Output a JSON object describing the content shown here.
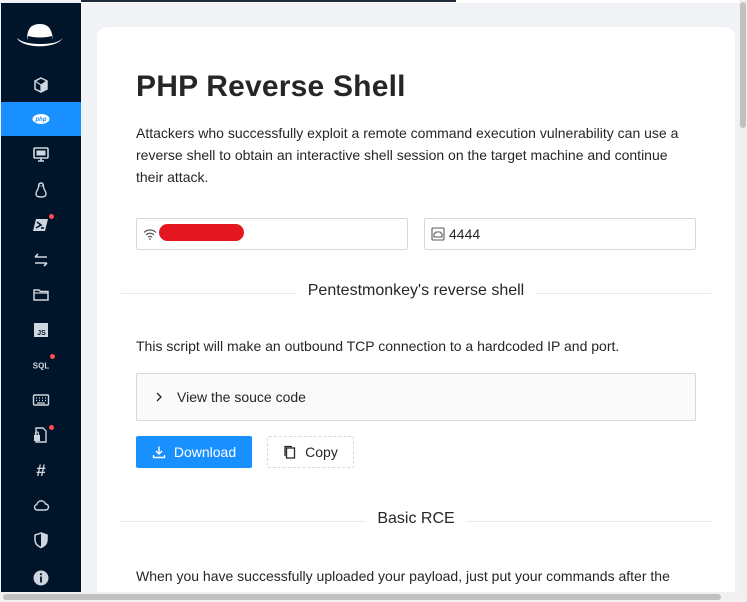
{
  "sidebar": {
    "items": [
      {
        "icon": "box-icon",
        "active": false,
        "badge": false
      },
      {
        "icon": "php-icon",
        "active": true,
        "badge": false
      },
      {
        "icon": "monitor-icon",
        "active": false,
        "badge": false
      },
      {
        "icon": "linux-icon",
        "active": false,
        "badge": false
      },
      {
        "icon": "powershell-icon",
        "active": false,
        "badge": true
      },
      {
        "icon": "swap-icon",
        "active": false,
        "badge": false
      },
      {
        "icon": "folder-icon",
        "active": false,
        "badge": false
      },
      {
        "icon": "javascript-icon",
        "active": false,
        "badge": false
      },
      {
        "icon": "sql-icon",
        "active": false,
        "badge": true
      },
      {
        "icon": "keyboard-icon",
        "active": false,
        "badge": false
      },
      {
        "icon": "file-lock-icon",
        "active": false,
        "badge": true
      },
      {
        "icon": "hash-icon",
        "active": false,
        "badge": false
      },
      {
        "icon": "cloud-icon",
        "active": false,
        "badge": false
      },
      {
        "icon": "shield-icon",
        "active": false,
        "badge": false
      },
      {
        "icon": "info-icon",
        "active": false,
        "badge": false
      }
    ],
    "php_text": "php",
    "sql_text": "SQL",
    "js_text": "JS",
    "hash_text": "#"
  },
  "main": {
    "title": "PHP Reverse Shell",
    "intro": "Attackers who successfully exploit a remote command execution vulnerability can use a reverse shell to obtain an interactive shell session on the target machine and continue their attack.",
    "ip_input": {
      "value": ""
    },
    "port_input": {
      "value": "4444"
    },
    "section1": "Pentestmonkey's reverse shell",
    "script_desc": "This script will make an outbound TCP connection to a hardcoded IP and port.",
    "collapse_label": "View the souce code",
    "download_label": "Download",
    "copy_label": "Copy",
    "section2": "Basic RCE",
    "rce_desc": "When you have successfully uploaded your payload, just put your commands after the"
  },
  "colors": {
    "sidebar_bg": "#001529",
    "accent": "#1890ff",
    "badge": "#ff4d4f",
    "redaction": "#e4161f"
  }
}
